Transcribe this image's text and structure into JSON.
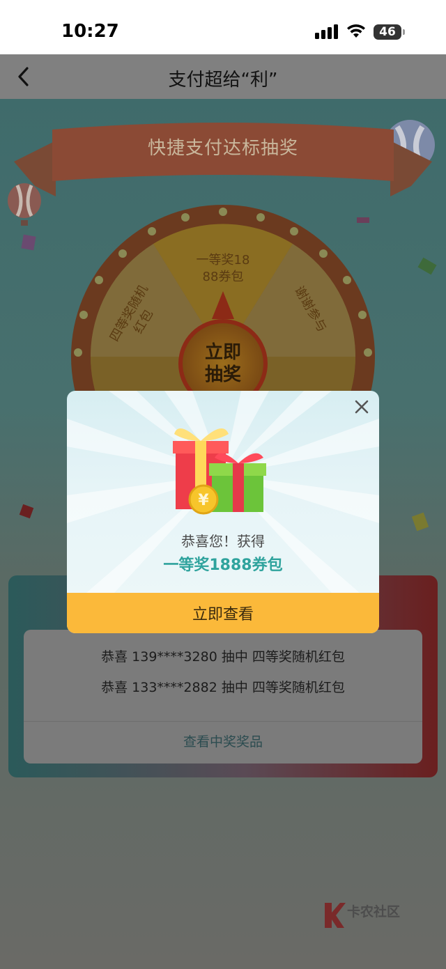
{
  "status_bar": {
    "time": "10:27",
    "battery": "46"
  },
  "nav": {
    "title": "支付超给“利”"
  },
  "banner": {
    "text": "快捷支付达标抽奖"
  },
  "wheel": {
    "segments": [
      "一等奖18 88券包",
      "四等奖随机 红包",
      "谢谢参与"
    ],
    "center_button": "立即 抽奖"
  },
  "winners": {
    "rows": [
      "恭喜 139****3280 抽中 四等奖随机红包",
      "恭喜 133****2882 抽中 四等奖随机红包"
    ],
    "view_prizes_link": "查看中奖奖品"
  },
  "modal": {
    "congrats": "恭喜您！获得",
    "prize": "一等奖1888券包",
    "button": "立即查看"
  },
  "watermark": {
    "text": "卡农社区"
  },
  "colors": {
    "modal_button": "#fbb93a",
    "prize_text": "#2fa39d",
    "overlay_page": "#48706e"
  }
}
